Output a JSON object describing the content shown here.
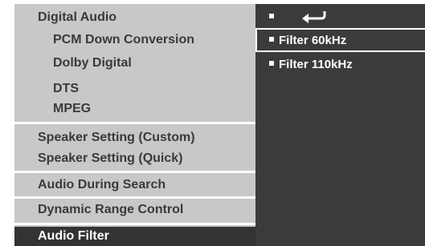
{
  "left_menu": {
    "digital_audio": "Digital Audio",
    "pcm_down": "PCM Down Conversion",
    "dolby": "Dolby Digital",
    "dts": "DTS",
    "mpeg": "MPEG",
    "speaker_custom": "Speaker Setting (Custom)",
    "speaker_quick": "Speaker Setting (Quick)",
    "audio_search": "Audio  During Search",
    "drc": "Dynamic Range Control",
    "audio_filter": "Audio Filter"
  },
  "right_menu": {
    "back_icon": "return-arrow-icon",
    "options": [
      "Filter 60kHz",
      "Filter 110kHz"
    ],
    "selected_option": "Filter 60kHz"
  },
  "colors": {
    "left_bg": "#c8c8c8",
    "right_bg": "#3b3b3b",
    "selected_bg": "#333333",
    "text_dark": "#3a3a3a",
    "text_light": "#ffffff"
  }
}
